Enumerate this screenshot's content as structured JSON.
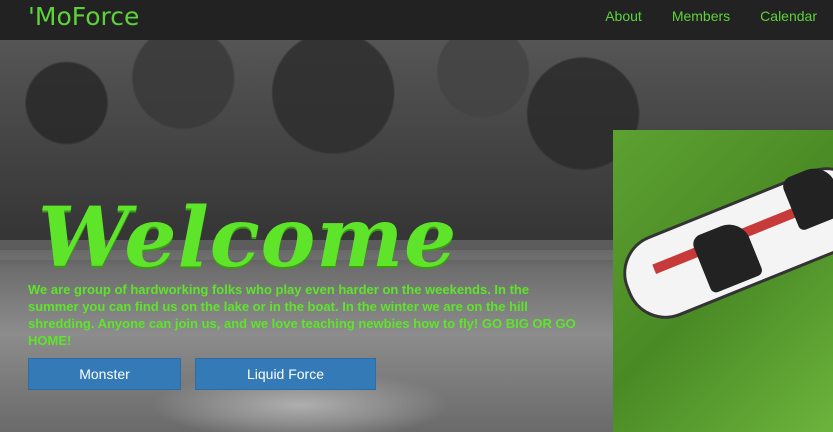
{
  "navbar": {
    "brand": "'MoForce",
    "links": [
      {
        "label": "About"
      },
      {
        "label": "Members"
      },
      {
        "label": "Calendar"
      }
    ]
  },
  "hero": {
    "heading": "Welcome",
    "intro": "We are group of hardworking folks who play even harder on the weekends. In the summer you can find us on the lake or in the boat. In the winter we are on the hill shredding. Anyone can join us, and we love teaching newbies how to fly! GO BIG OR GO HOME!",
    "buttons": [
      {
        "label": "Monster"
      },
      {
        "label": "Liquid Force"
      }
    ]
  },
  "colors": {
    "accent": "#5ee52a",
    "navbar_bg": "#222222",
    "button_bg": "#337ab7"
  }
}
